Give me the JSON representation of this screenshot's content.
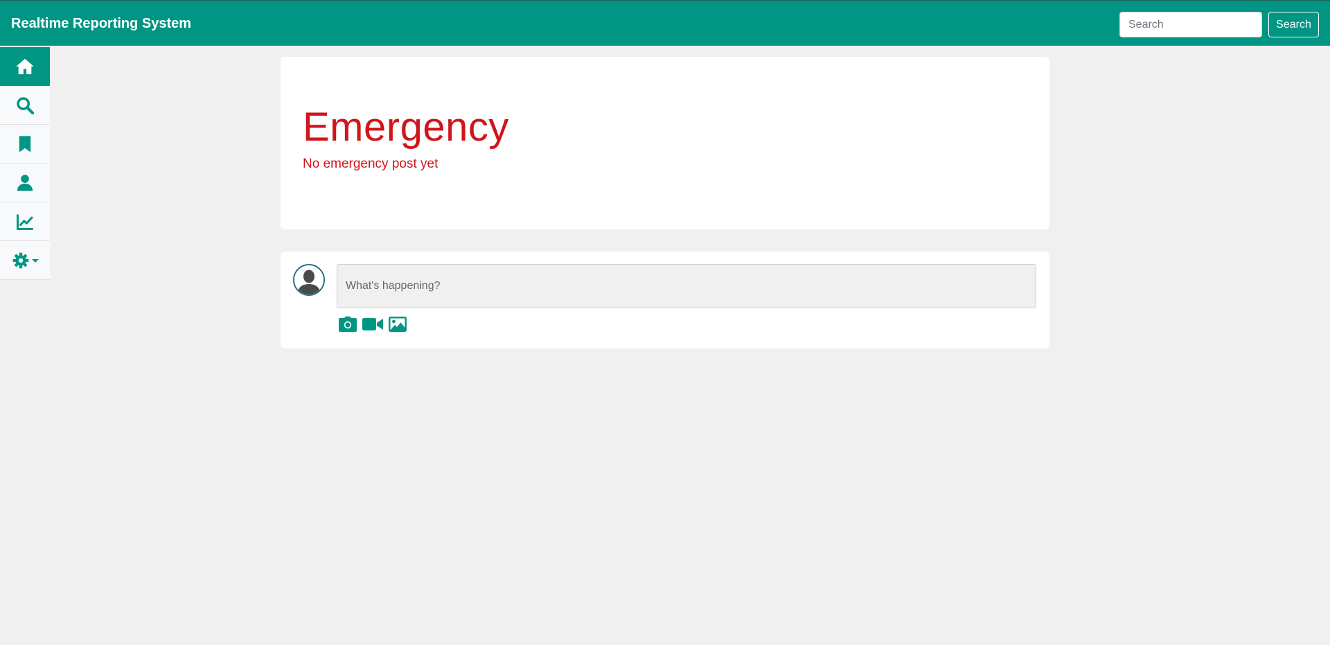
{
  "header": {
    "brand": "Realtime Reporting System",
    "search_placeholder": "Search",
    "search_button": "Search"
  },
  "sidebar": {
    "items": [
      {
        "name": "home",
        "icon": "home-icon",
        "active": true
      },
      {
        "name": "search",
        "icon": "search-icon",
        "active": false
      },
      {
        "name": "bookmarks",
        "icon": "bookmark-icon",
        "active": false
      },
      {
        "name": "profile",
        "icon": "user-icon",
        "active": false
      },
      {
        "name": "analytics",
        "icon": "chart-line-icon",
        "active": false
      },
      {
        "name": "settings",
        "icon": "gear-icon",
        "active": false
      }
    ]
  },
  "emergency": {
    "title": "Emergency",
    "message": "No emergency post yet"
  },
  "composer": {
    "placeholder": "What's happening?",
    "media_icons": [
      "camera-icon",
      "video-icon",
      "image-icon"
    ]
  },
  "colors": {
    "brand": "#009683",
    "emergency": "#d0151b",
    "background": "#f0f0f0"
  }
}
